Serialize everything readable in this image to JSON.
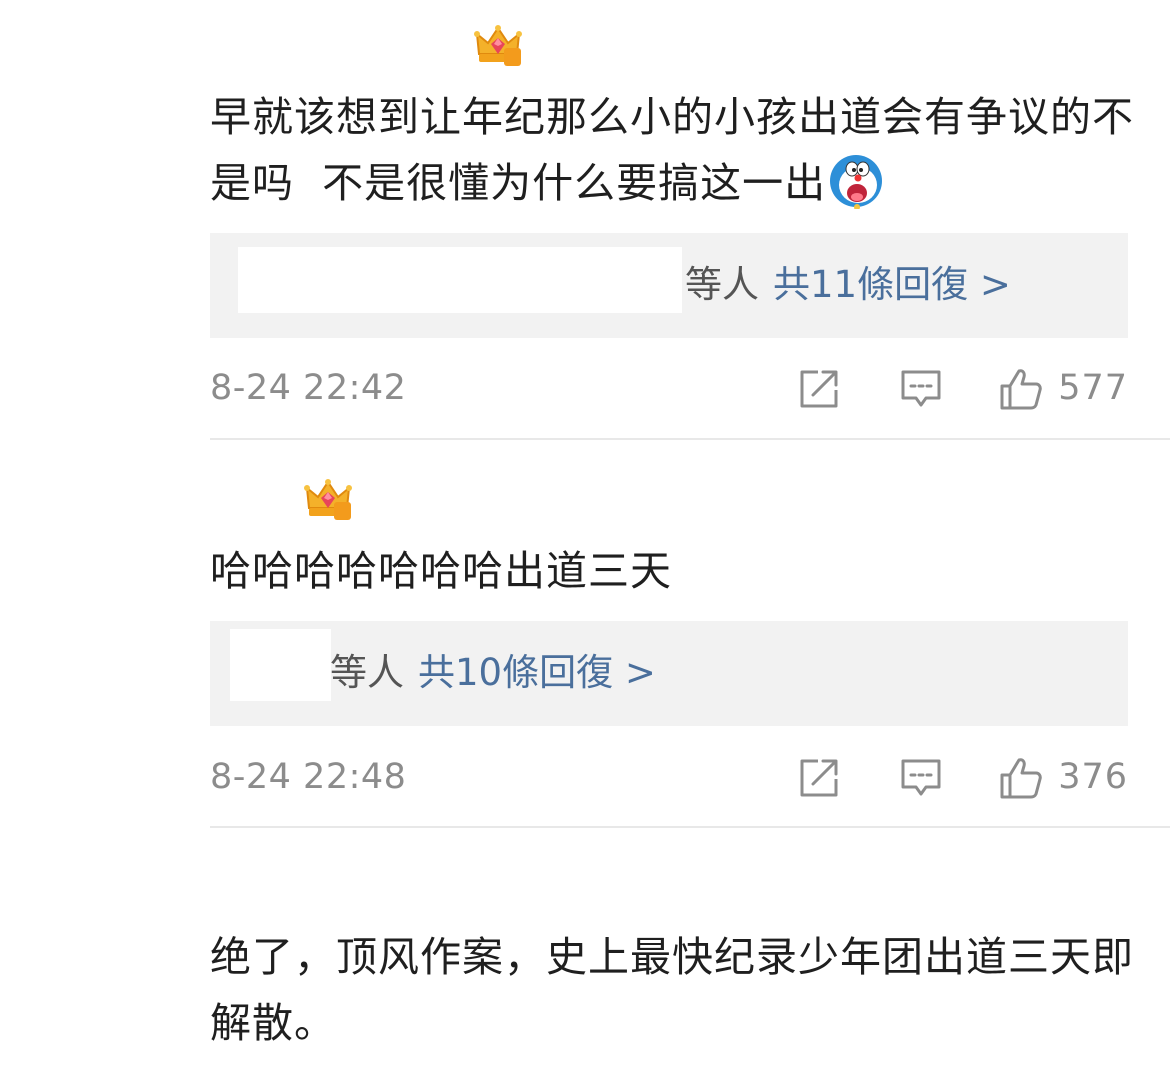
{
  "comments": [
    {
      "badge_level": "6",
      "text": "早就该想到让年纪那么小的小孩出道会有争议的不是吗  不是很懂为什么要搞这一出",
      "emoji_icon": "doraemon-emoji-icon",
      "replies": {
        "who": "等人",
        "count": "共11條回復 >"
      },
      "time": "8-24 22:42",
      "likes": "577"
    },
    {
      "badge_level": "6",
      "text": "哈哈哈哈哈哈哈出道三天",
      "replies": {
        "who": "等人",
        "count": "共10條回復 >"
      },
      "time": "8-24 22:48",
      "likes": "376"
    },
    {
      "text": "绝了，顶风作案，史上最快纪录少年团出道三天即解散。"
    }
  ],
  "icons": {
    "badge": "crown-level-badge-icon",
    "share": "share-icon",
    "comment": "comment-icon",
    "like": "thumbs-up-icon"
  },
  "colors": {
    "reply_link": "#4a6f9c",
    "reply_bg": "#f2f2f2",
    "meta_text": "#8c8c8c"
  }
}
